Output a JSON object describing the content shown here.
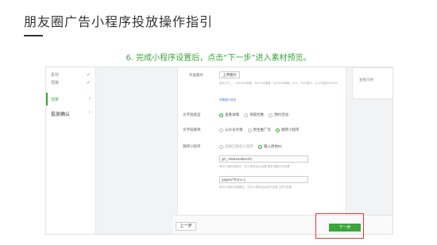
{
  "slide": {
    "title": "朋友圈广告小程序投放操作指引",
    "caption": "6. 完成小程序设置后，点击“下一步”进入素材预览。"
  },
  "sidebar": {
    "items": [
      {
        "label": "素材",
        "checked": true
      },
      {
        "label": "预算",
        "checked": true
      },
      {
        "label": "创意",
        "active": true
      },
      {
        "label": "投放确认",
        "section": true
      }
    ]
  },
  "form": {
    "image_label": "外层图片",
    "upload_button": "上传图片",
    "image_hint": "图片尺寸，：800*800像素，800*450像素，800*640像素；JPG、PNG格式，大小不超过300KB",
    "image_hint_link": "查看图片规范",
    "text_link_label": "文字链类型",
    "text_link_options": [
      "查看详情",
      "领取优惠",
      "预约活动"
    ],
    "text_link_selected": 0,
    "link_label": "文字链跳转",
    "link_options": [
      "公众号文章",
      "原生推广页",
      "跳转小程序"
    ],
    "link_selected": 2,
    "mini_label": "跳转小程序",
    "mini_options": [
      "选择已授权小程序",
      "输入原始ID"
    ],
    "mini_selected": 1,
    "mini_id_value": "gh_c0594ea90c4f1",
    "mini_id_hint": "填写小程序原始ID，在小程序后台设置-基本设置中可查看",
    "page_path_value": "pages/?from=1",
    "page_path_hint": "填写小程序页面路径，可在小程序后台或开发者工具中查看"
  },
  "preview": {
    "text": "查看示例"
  },
  "footer": {
    "prev_label": "上一步",
    "next_label": "下一步"
  },
  "colors": {
    "accent": "#3aa53a",
    "highlight": "#e53935"
  }
}
